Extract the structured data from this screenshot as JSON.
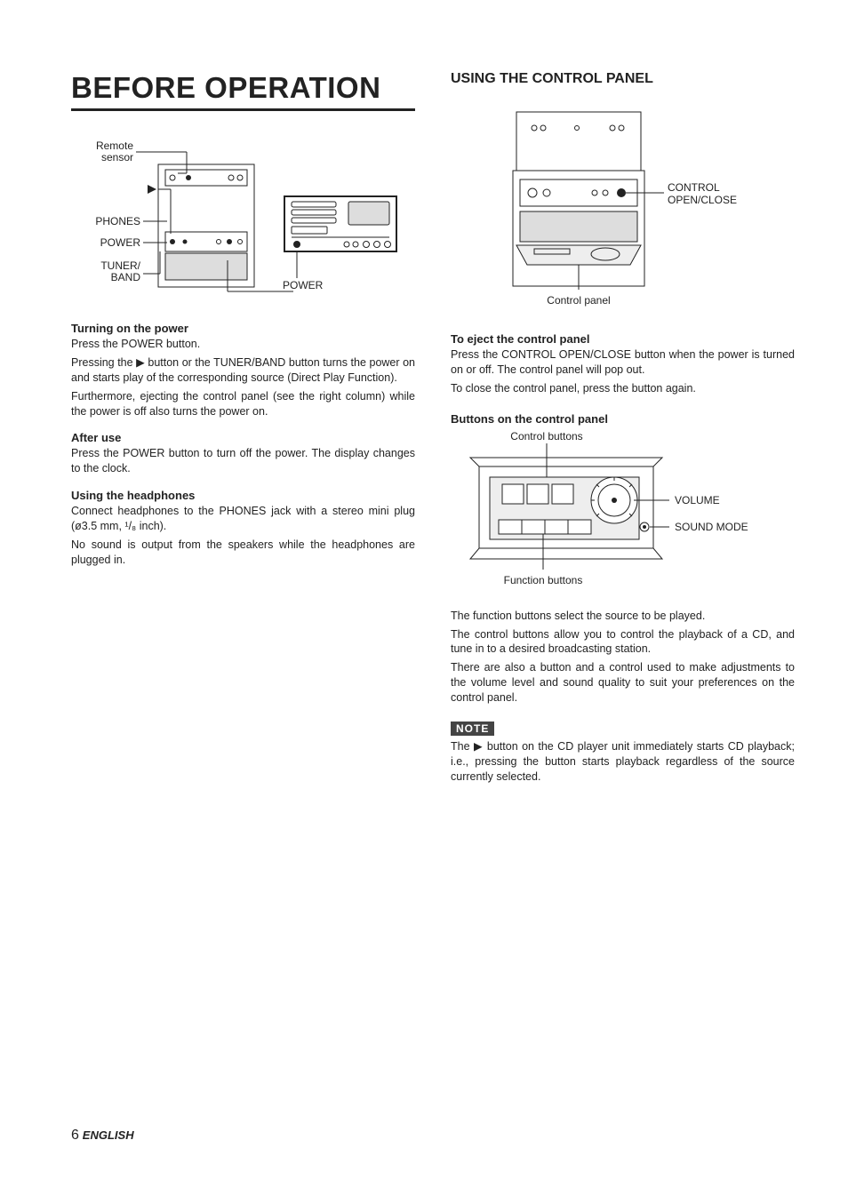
{
  "left": {
    "title": "BEFORE OPERATION",
    "fig1": {
      "remote_sensor": "Remote\nsensor",
      "phones": "PHONES",
      "power_l": "POWER",
      "tuner_band": "TUNER/\nBAND",
      "power_r": "POWER"
    },
    "sec1_h": "Turning on the power",
    "sec1_p1": "Press the POWER button.",
    "sec1_p2": "Pressing the ▶ button or the TUNER/BAND button turns the power on and starts play of the corresponding source (Direct Play Function).",
    "sec1_p3": "Furthermore, ejecting the control panel (see the right column) while the power is off also turns the power on.",
    "sec2_h": "After use",
    "sec2_p1": "Press the POWER button to turn off the power. The display changes to the clock.",
    "sec3_h": "Using the headphones",
    "sec3_p1": "Connect headphones to the PHONES jack with a stereo mini plug (ø3.5 mm, ¹/₈ inch).",
    "sec3_p2": "No sound is output from the speakers while the headphones are plugged in."
  },
  "right": {
    "title": "USING THE CONTROL PANEL",
    "fig2": {
      "control_open_close": "CONTROL\nOPEN/CLOSE",
      "control_panel": "Control panel"
    },
    "sec1_h": "To eject the control panel",
    "sec1_p1": "Press the CONTROL OPEN/CLOSE button when the power is turned on or off. The control panel will pop out.",
    "sec1_p2": "To close the control panel, press the button again.",
    "sec2_h": "Buttons on the control panel",
    "fig3": {
      "control_buttons": "Control buttons",
      "volume": "VOLUME",
      "sound_mode": "SOUND MODE",
      "function_buttons": "Function buttons"
    },
    "sec2_p1": "The function buttons select the source to be played.",
    "sec2_p2": "The control buttons allow you to control the playback of a CD, and tune in to a desired broadcasting station.",
    "sec2_p3": "There are also a button and a control used to make adjustments to the volume level and sound quality to suit your preferences on the control panel.",
    "note_label": "NOTE",
    "note_p": "The ▶ button on the CD player unit immediately starts CD playback; i.e., pressing the button starts playback regardless of the source currently selected."
  },
  "footer": {
    "page": "6",
    "lang": "ENGLISH"
  }
}
